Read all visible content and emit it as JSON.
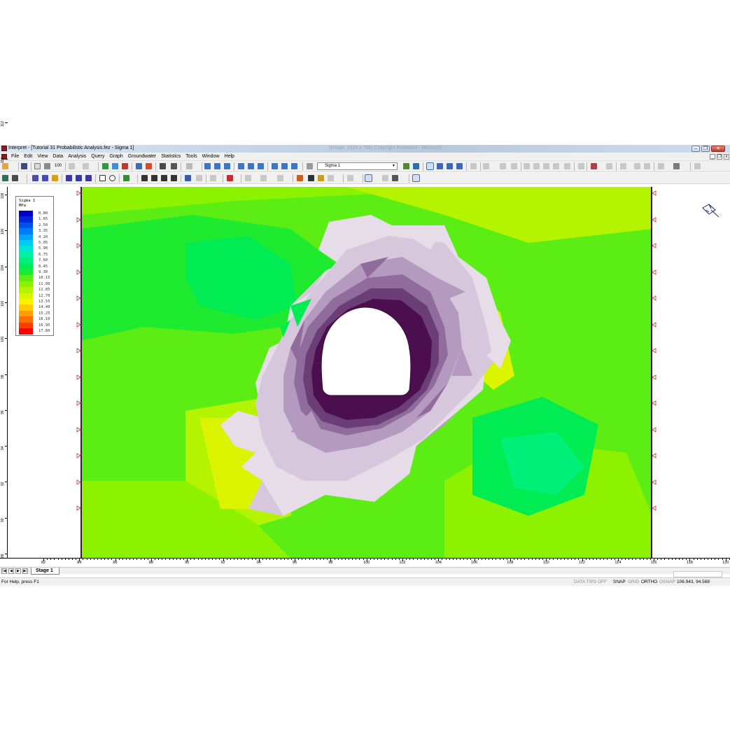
{
  "window": {
    "title": "Interpret - [Tutorial 31 Probabilistic Analysis.fez - Sigma 1]",
    "background_title": "(Image, 1024 x 768) Copyright Protected - Microsoft...",
    "buttons": {
      "minimize": "–",
      "restore": "❐",
      "close": "✕"
    }
  },
  "menu": {
    "items": [
      "File",
      "Edit",
      "View",
      "Data",
      "Analysis",
      "Query",
      "Graph",
      "Groundwater",
      "Statistics",
      "Tools",
      "Window",
      "Help"
    ],
    "mdi": {
      "minimize": "_",
      "restore": "❐",
      "close": "x"
    }
  },
  "toolbar": {
    "zoom_text": "100",
    "data_select_value": "Sigma 1",
    "icons": [
      "open-icon",
      "save-icon",
      "print-preview-icon",
      "print-icon",
      "undo-icon",
      "redo-icon",
      "grid-icon",
      "mesh-icon",
      "chart-icon",
      "zoom-in-icon",
      "zoom-out-icon",
      "zoom-window-icon",
      "zoom-all-icon",
      "pan-icon",
      "contour-icon",
      "settings-icon"
    ]
  },
  "legend": {
    "title": "Sigma 1",
    "units": "MPa",
    "entries": [
      {
        "value": "0.80",
        "color": "#0000c8"
      },
      {
        "value": "1.65",
        "color": "#0026dc"
      },
      {
        "value": "2.50",
        "color": "#0050ee"
      },
      {
        "value": "3.35",
        "color": "#007cf8"
      },
      {
        "value": "4.20",
        "color": "#00a6fa"
      },
      {
        "value": "5.05",
        "color": "#00ccf0"
      },
      {
        "value": "5.90",
        "color": "#00e6d2"
      },
      {
        "value": "6.75",
        "color": "#00f0a8"
      },
      {
        "value": "7.60",
        "color": "#00f07a"
      },
      {
        "value": "8.45",
        "color": "#00ec52"
      },
      {
        "value": "9.30",
        "color": "#1eea30"
      },
      {
        "value": "10.15",
        "color": "#5cee14"
      },
      {
        "value": "11.00",
        "color": "#8cf200"
      },
      {
        "value": "11.85",
        "color": "#b4f400"
      },
      {
        "value": "12.70",
        "color": "#dcf400"
      },
      {
        "value": "13.55",
        "color": "#fff000"
      },
      {
        "value": "14.40",
        "color": "#ffcc00"
      },
      {
        "value": "15.25",
        "color": "#ff9e00"
      },
      {
        "value": "16.10",
        "color": "#ff6e00"
      },
      {
        "value": "16.95",
        "color": "#ff3c00"
      },
      {
        "value": "17.80",
        "color": "#ff0000"
      }
    ]
  },
  "rulers": {
    "bottom": [
      "82",
      "84",
      "86",
      "88",
      "90",
      "92",
      "94",
      "96",
      "98",
      "100",
      "102",
      "104",
      "106",
      "108",
      "110",
      "112",
      "114",
      "116",
      "118",
      "120"
    ],
    "left": [
      "88",
      "90",
      "92",
      "94",
      "96",
      "98",
      "100",
      "102",
      "104",
      "106",
      "108",
      "110",
      "112"
    ]
  },
  "tabs": {
    "nav": [
      "|◀",
      "◀",
      "▶",
      "▶|"
    ],
    "active": "Stage 1"
  },
  "status": {
    "help": "For Help, press F1",
    "data_tips": "DATA TIPS OFF",
    "snap": "SNAP",
    "grid": "GRID",
    "ortho": "ORTHO",
    "osnap": "OSNAP",
    "coords": "106.943, 94.568"
  },
  "colors": {
    "yielded_light": "#e6dde9",
    "yielded_mid1": "#d7c7dc",
    "yielded_mid2": "#b49abf",
    "yielded_mid3": "#8f6c9b",
    "yielded_dark": "#6b3e77",
    "yielded_core": "#4b0f4f",
    "field_green": "#58e61e"
  }
}
